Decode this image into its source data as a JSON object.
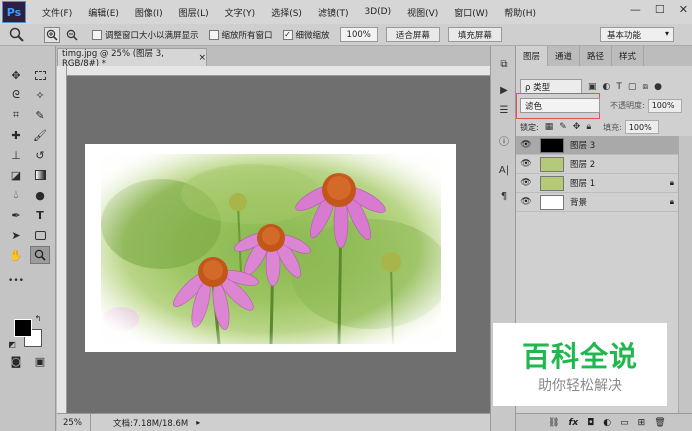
{
  "app": {
    "logo": "Ps",
    "window_controls": [
      "—",
      "☐",
      "✕"
    ]
  },
  "menu": [
    "文件(F)",
    "编辑(E)",
    "图像(I)",
    "图层(L)",
    "文字(Y)",
    "选择(S)",
    "滤镜(T)",
    "3D(D)",
    "视图(V)",
    "窗口(W)",
    "帮助(H)"
  ],
  "options": {
    "resize_windows": "调整窗口大小以满屏显示",
    "zoom_all_windows": "缩放所有窗口",
    "scrubby_zoom": "细微缩放",
    "zoom_value": "100%",
    "fit_screen": "适合屏幕",
    "fill_screen": "填充屏幕",
    "workspace": "基本功能"
  },
  "document": {
    "tab_title": "timg.jpg @ 25% (图层 3, RGB/8#) *",
    "tab_close": "×",
    "status_zoom": "25%",
    "status_doc": "文档:7.18M/18.6M"
  },
  "layers_panel": {
    "tabs": [
      "图层",
      "通道",
      "路径",
      "样式"
    ],
    "filter_label": "ρ 类型",
    "blend_mode": "滤色",
    "opacity_label": "不透明度:",
    "opacity_value": "100%",
    "lock_label": "锁定:",
    "fill_label": "填充:",
    "fill_value": "100%",
    "layers": [
      {
        "name": "图层 3",
        "selected": true,
        "thumb": "#000000",
        "locked": false
      },
      {
        "name": "图层 2",
        "selected": false,
        "thumb": "#b5c97a",
        "locked": false
      },
      {
        "name": "图层 1",
        "selected": false,
        "thumb": "#b5c97a",
        "locked": true
      },
      {
        "name": "背景",
        "selected": false,
        "thumb": "#ffffff",
        "locked": true
      }
    ],
    "footer_icons": [
      "link-icon",
      "fx-icon",
      "mask-icon",
      "adjustment-icon",
      "folder-icon",
      "new-layer-icon",
      "trash-icon"
    ],
    "fx_label": "fx"
  },
  "watermark": {
    "title": "百科全说",
    "subtitle": "助你轻松解决"
  }
}
